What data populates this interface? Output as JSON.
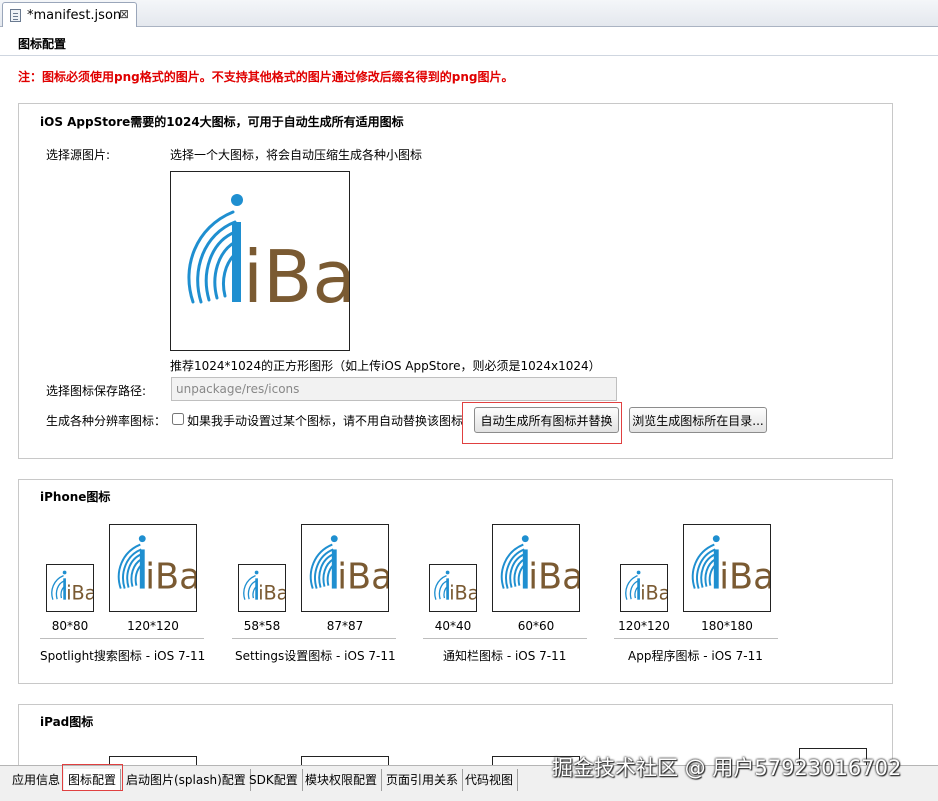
{
  "editor": {
    "tab_title": "*manifest.json",
    "tab_close": "⊠"
  },
  "section": {
    "title": "图标配置",
    "warning": "注：图标必须使用png格式的图片。不支持其他格式的图片通过修改后缀名得到的png图片。"
  },
  "ios_appstore": {
    "title": "iOS AppStore需要的1024大图标，可用于自动生成所有适用图标",
    "source_label": "选择源图片:",
    "source_hint": "选择一个大图标，将会自动压缩生成各种小图标",
    "preview_logo": "iBag",
    "recommend": "推荐1024*1024的正方形图形（如上传iOS AppStore，则必须是1024x1024）",
    "save_path_label": "选择图标保存路径:",
    "save_path_value": "unpackage/res/icons",
    "generate_label": "生成各种分辨率图标：",
    "checkbox_label": "如果我手动设置过某个图标，请不用自动替换该图标",
    "auto_generate_button": "自动生成所有图标并替换",
    "browse_button": "浏览生成图标所在目录..."
  },
  "iphone": {
    "title": "iPhone图标",
    "logo": "iBag",
    "groups": [
      {
        "name": "Spotlight搜索图标 - iOS 7-11",
        "sizes": [
          "80*80",
          "120*120"
        ]
      },
      {
        "name": "Settings设置图标 - iOS 7-11",
        "sizes": [
          "58*58",
          "87*87"
        ]
      },
      {
        "name": "通知栏图标 - iOS 7-11",
        "sizes": [
          "40*40",
          "60*60"
        ]
      },
      {
        "name": "App程序图标 - iOS 7-11",
        "sizes": [
          "120*120",
          "180*180"
        ]
      }
    ]
  },
  "ipad": {
    "title": "iPad图标"
  },
  "bottom_tabs": [
    "应用信息",
    "图标配置",
    "启动图片(splash)配置",
    "SDK配置",
    "模块权限配置",
    "页面引用关系",
    "代码视图"
  ],
  "active_tab": "图标配置",
  "watermark": "掘金技术社区 @ 用户57923016702",
  "colors": {
    "warning": "#e00000",
    "logo_blue": "#1f8fd0",
    "logo_brown": "#7a5a32",
    "highlight": "#e04040"
  }
}
